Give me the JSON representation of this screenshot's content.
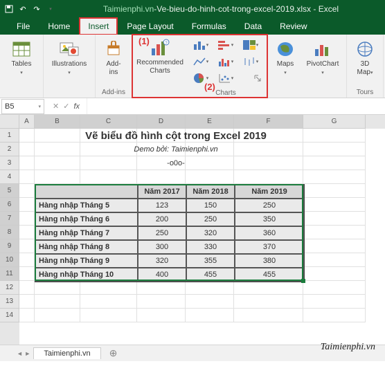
{
  "titlebar": {
    "filename_hl": "Taimienphi.vn",
    "filename_rest": "-Ve-bieu-do-hinh-cot-trong-excel-2019.xlsx  -  Excel"
  },
  "tabs": {
    "file": "File",
    "home": "Home",
    "insert": "Insert",
    "pagelayout": "Page Layout",
    "formulas": "Formulas",
    "data": "Data",
    "review": "Review"
  },
  "ribbon": {
    "tables": "Tables",
    "illustrations": "Illustrations",
    "addins_label": "Add-\nins",
    "addins_group": "Add-ins",
    "reccharts_label": "Recommended\nCharts",
    "charts_group": "Charts",
    "maps": "Maps",
    "pivotchart": "PivotChart",
    "map3d_label": "3D\nMap",
    "tours": "Tours"
  },
  "annot": {
    "a1": "(1)",
    "a2": "(2)"
  },
  "namebox": "B5",
  "fx": "fx",
  "cols": [
    "A",
    "B",
    "C",
    "D",
    "E",
    "F",
    "G"
  ],
  "rows": [
    "1",
    "2",
    "3",
    "4",
    "5",
    "6",
    "7",
    "8",
    "9",
    "10",
    "11",
    "12",
    "13",
    "14"
  ],
  "content": {
    "title": "Vẽ biểu đồ hình cột trong Excel 2019",
    "subtitle": "Demo bởi: Taimienphi.vn",
    "ooo": "-o0o-"
  },
  "table": {
    "headers": [
      "",
      "Năm 2017",
      "Năm 2018",
      "Năm 2019"
    ],
    "rows": [
      [
        "Hàng nhập Tháng 5",
        "123",
        "150",
        "250"
      ],
      [
        "Hàng nhập Tháng 6",
        "200",
        "250",
        "350"
      ],
      [
        "Hàng nhập Tháng 7",
        "250",
        "320",
        "360"
      ],
      [
        "Hàng nhập Tháng 8",
        "300",
        "330",
        "370"
      ],
      [
        "Hàng nhập Tháng 9",
        "320",
        "355",
        "380"
      ],
      [
        "Hàng nhập Tháng 10",
        "400",
        "455",
        "455"
      ]
    ]
  },
  "sheet_tab": "Taimienphi.vn",
  "watermark": "Taimienphi.vn"
}
